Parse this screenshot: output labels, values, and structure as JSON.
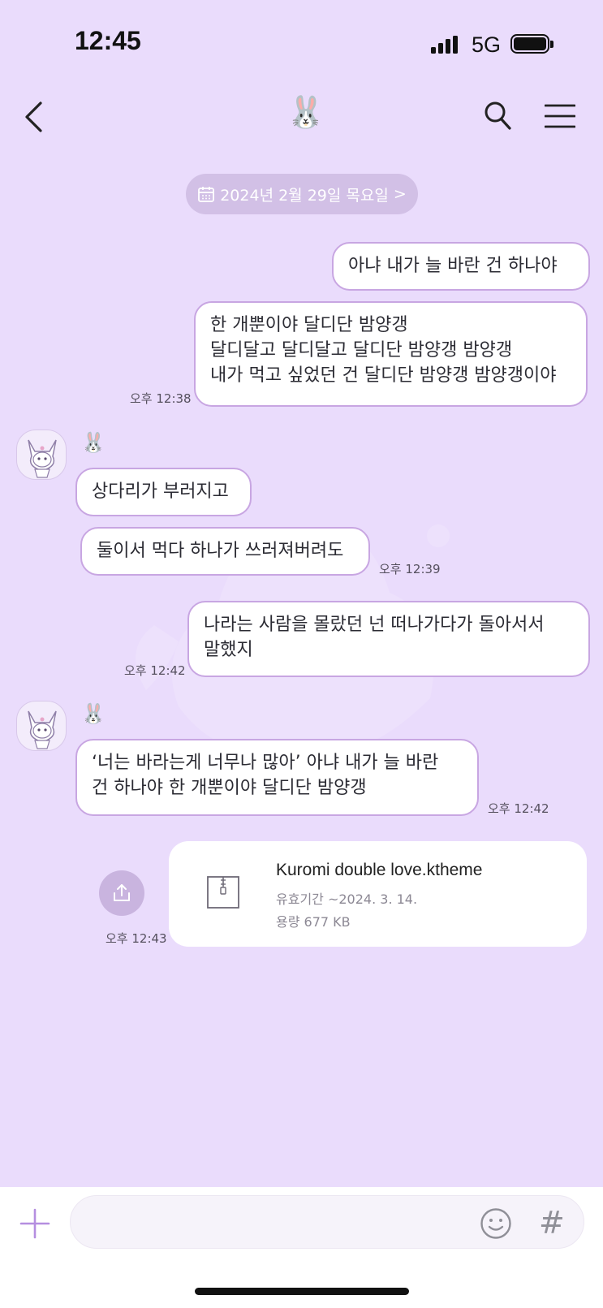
{
  "status_bar": {
    "time": "12:45",
    "network": "5G",
    "battery_fill": 1.0
  },
  "header": {
    "title_emoji": "🐰",
    "icons": [
      "back-icon",
      "search-icon",
      "menu-icon"
    ]
  },
  "date_divider": {
    "label": "2024년 2월 29일 목요일",
    "chevron": ">"
  },
  "messages": [
    {
      "side": "me",
      "lines": [
        "아냐 내가 늘 바란 건 하나야"
      ],
      "time": ""
    },
    {
      "side": "me",
      "lines": [
        "한 개뿐이야 달디단 밤양갱",
        "달디달고 달디달고 달디단 밤양갱 밤양갱",
        "내가 먹고 싶었던 건 달디단 밤양갱 밤양갱이야"
      ],
      "time": "오후 12:38"
    },
    {
      "side": "other",
      "sender": "🐰",
      "lines": [
        "상다리가 부러지고"
      ],
      "time": ""
    },
    {
      "side": "other",
      "lines": [
        "둘이서 먹다 하나가 쓰러져버려도"
      ],
      "time": "오후 12:39"
    },
    {
      "side": "me",
      "lines": [
        "나라는 사람을 몰랐던 넌 떠나가다가 돌아서서",
        "말했지"
      ],
      "time": "오후 12:42"
    },
    {
      "side": "other",
      "sender": "🐰",
      "lines": [
        "‘너는 바라는게 너무나 많아’ 아냐 내가 늘 바란",
        "건 하나야 한 개뿐이야 달디단 밤양갱"
      ],
      "time": "오후 12:42"
    }
  ],
  "file_message": {
    "name": "Kuromi double love.ktheme",
    "expiry": "유효기간 ~2024. 3. 14.",
    "size": "용량 677 KB",
    "time": "오후 12:43",
    "icons": [
      "share-icon",
      "zip-file-icon"
    ]
  },
  "input": {
    "value": "",
    "placeholder": "",
    "icons": [
      "plus-icon",
      "emoji-icon"
    ],
    "hash_label": "#"
  },
  "colors": {
    "background": "#eadcfc",
    "bubble_border": "#c8a6e2",
    "date_pill": "#d2c0e6",
    "accent": "#b58ee0"
  }
}
